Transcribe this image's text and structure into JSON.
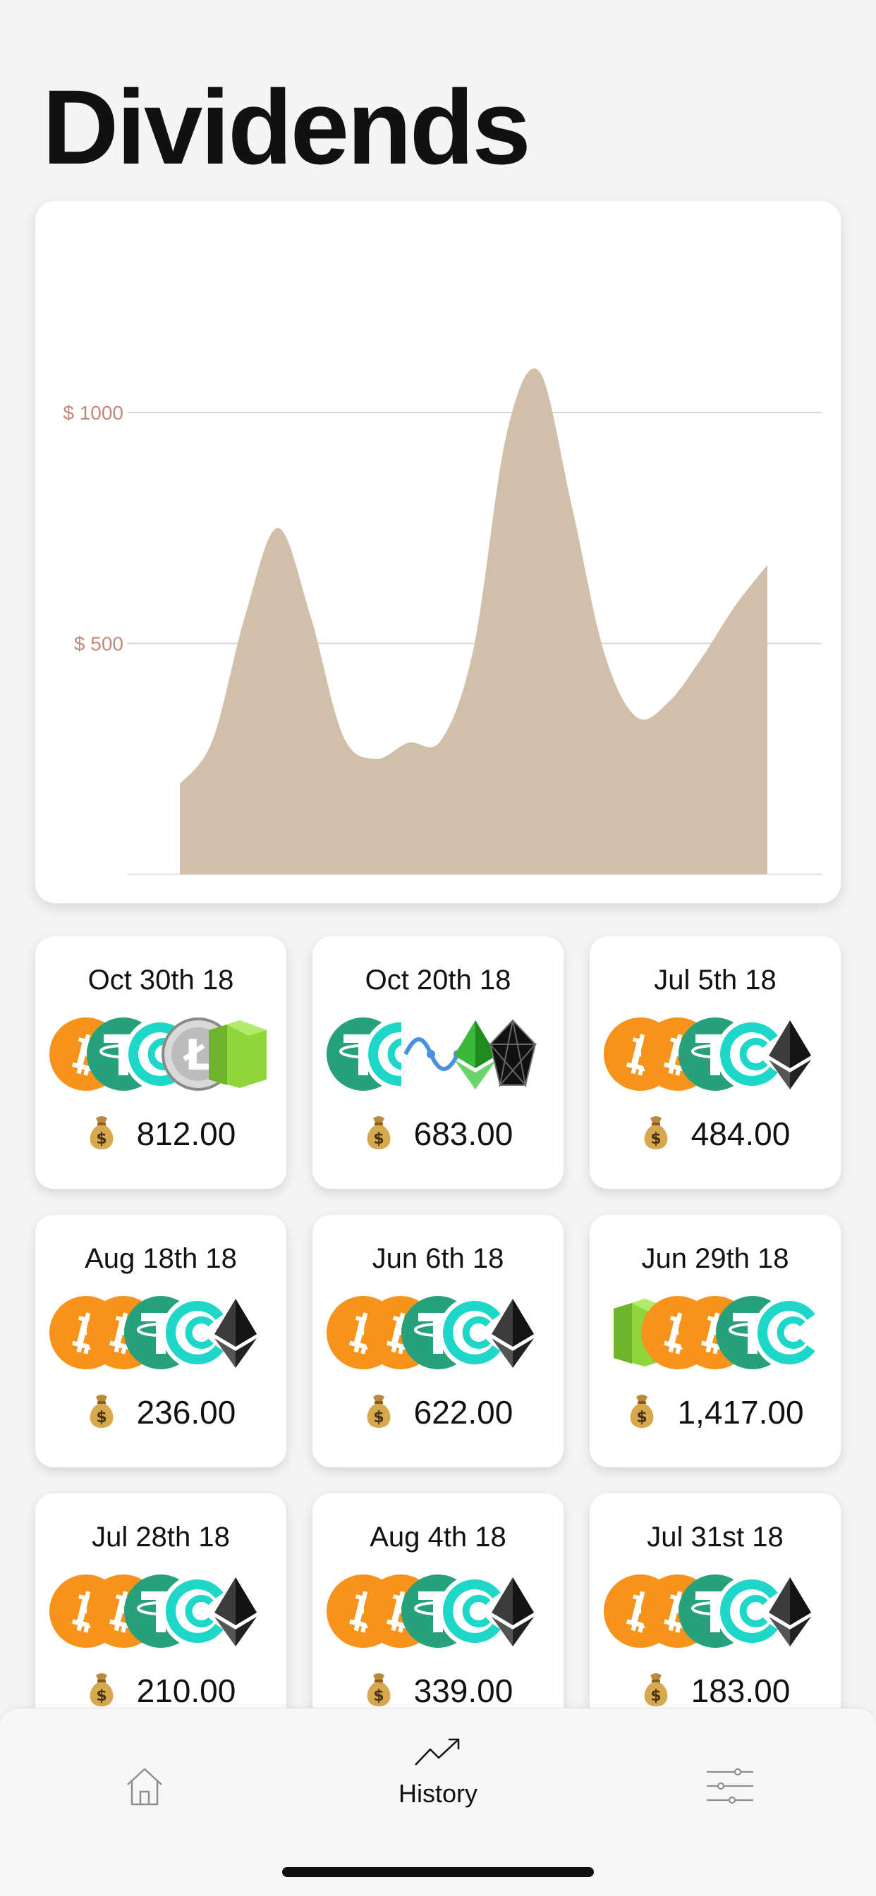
{
  "page": {
    "title": "Dividends"
  },
  "chart_data": {
    "type": "area",
    "color": "#d2bfa9",
    "yticks": [
      {
        "value": 1000,
        "label": "$ 1000"
      },
      {
        "value": 500,
        "label": "$ 500"
      }
    ],
    "ylim": [
      0,
      1000
    ],
    "x": [
      0,
      1,
      2,
      3,
      4,
      5,
      6,
      7,
      8,
      9,
      10,
      11,
      12,
      13,
      14,
      15,
      16,
      17,
      18
    ],
    "values": [
      195,
      290,
      560,
      750,
      560,
      300,
      250,
      285,
      290,
      490,
      950,
      1090,
      800,
      480,
      340,
      375,
      470,
      580,
      670
    ]
  },
  "cards": [
    {
      "date": "Oct 30th 18",
      "amount": "812.00",
      "coins": [
        "btc-icon",
        "usdt-icon",
        "cs-icon",
        "ltc-icon",
        "neo-icon"
      ]
    },
    {
      "date": "Oct 20th 18",
      "amount": "683.00",
      "coins": [
        "usdt-icon",
        "cs-icon",
        "nano-icon",
        "etc-icon",
        "eos-icon"
      ]
    },
    {
      "date": "Jul 5th 18",
      "amount": "484.00",
      "coins": [
        "btc-icon",
        "btc-icon",
        "usdt-icon",
        "cs-icon",
        "eth-icon"
      ]
    },
    {
      "date": "Aug 18th 18",
      "amount": "236.00",
      "coins": [
        "btc-icon",
        "btc-icon",
        "usdt-icon",
        "cs-icon",
        "eth-icon"
      ]
    },
    {
      "date": "Jun 6th 18",
      "amount": "622.00",
      "coins": [
        "btc-icon",
        "btc-icon",
        "usdt-icon",
        "cs-icon",
        "eth-icon"
      ]
    },
    {
      "date": "Jun 29th 18",
      "amount": "1,417.00",
      "coins": [
        "neo-icon",
        "btc-icon",
        "btc-icon",
        "usdt-icon",
        "cs-icon"
      ]
    },
    {
      "date": "Jul 28th 18",
      "amount": "210.00",
      "coins": [
        "btc-icon",
        "btc-icon",
        "usdt-icon",
        "cs-icon",
        "eth-icon"
      ]
    },
    {
      "date": "Aug 4th 18",
      "amount": "339.00",
      "coins": [
        "btc-icon",
        "btc-icon",
        "usdt-icon",
        "cs-icon",
        "eth-icon"
      ]
    },
    {
      "date": "Jul 31st 18",
      "amount": "183.00",
      "coins": [
        "btc-icon",
        "btc-icon",
        "usdt-icon",
        "cs-icon",
        "eth-icon"
      ]
    }
  ],
  "tabbar": {
    "tabs": [
      {
        "icon": "home-icon",
        "label": ""
      },
      {
        "icon": "trend-icon",
        "label": "History"
      },
      {
        "icon": "sliders-icon",
        "label": ""
      }
    ],
    "active_index": 1
  },
  "colors": {
    "btc": "#f7931a",
    "usdt": "#26a17b",
    "cs": "#1ed7c8",
    "neo": "#8fd63c",
    "eth": "#343434",
    "tick_label": "#c28a7a"
  }
}
